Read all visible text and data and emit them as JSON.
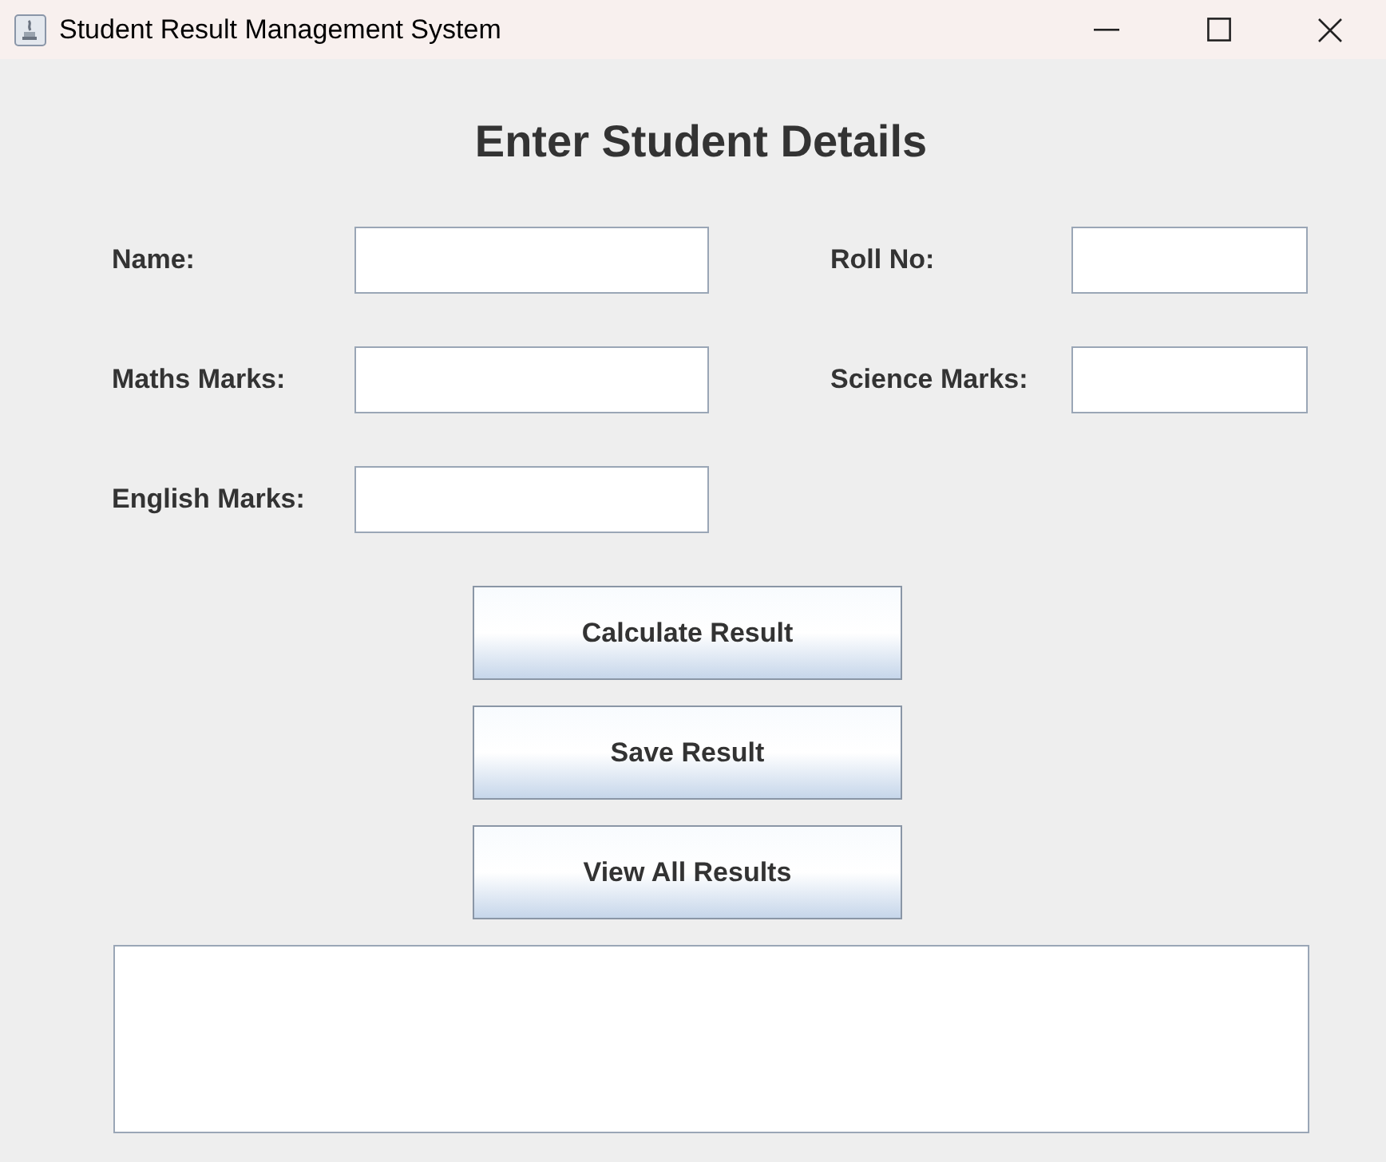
{
  "window": {
    "title": "Student Result Management System"
  },
  "heading": "Enter Student Details",
  "form_rows": [
    {
      "fields": [
        {
          "label": "Name:"
        },
        {
          "label": "Roll No:"
        }
      ]
    },
    {
      "fields": [
        {
          "label": "Maths Marks:"
        },
        {
          "label": "Science Marks:"
        }
      ]
    },
    {
      "fields": [
        {
          "label": "English Marks:"
        }
      ]
    }
  ],
  "buttons": [
    "Calculate Result",
    "Save Result",
    "View All Results"
  ]
}
